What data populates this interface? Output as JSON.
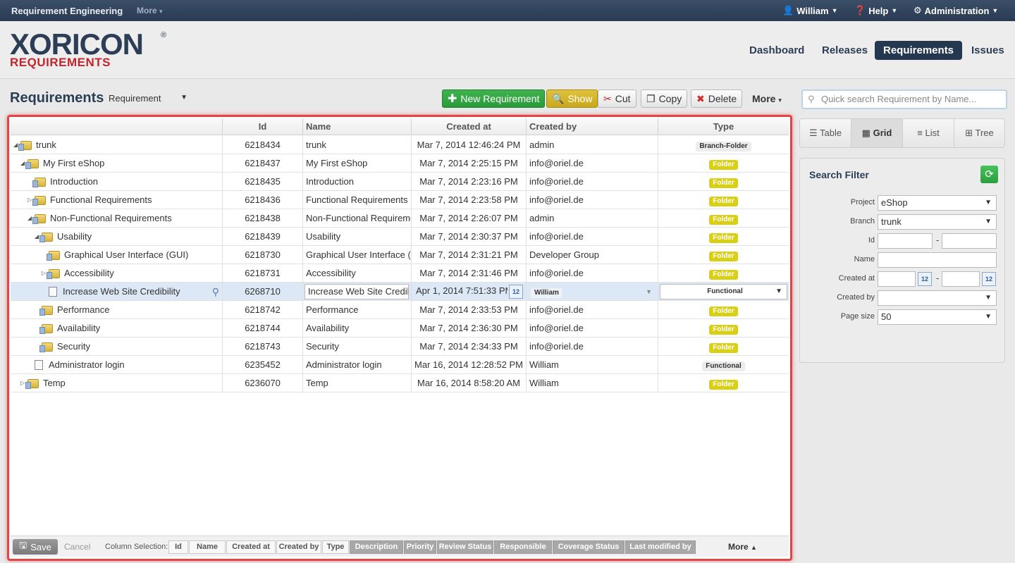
{
  "topbar": {
    "app_title": "Requirement Engineering",
    "more_label": "More",
    "user_label": "William",
    "help_label": "Help",
    "admin_label": "Administration"
  },
  "logo": {
    "main": "XORICON",
    "sub": "REQUIREMENTS",
    "reg": "®"
  },
  "nav": {
    "items": [
      {
        "label": "Dashboard"
      },
      {
        "label": "Releases"
      },
      {
        "label": "Requirements"
      },
      {
        "label": "Issues"
      }
    ],
    "active": "Requirements"
  },
  "toolbar": {
    "page_title": "Requirements",
    "type_select": "Requirement",
    "new_label": "New Requirement",
    "show_label": "Show",
    "cut_label": "Cut",
    "copy_label": "Copy",
    "delete_label": "Delete",
    "more_label": "More",
    "search_placeholder": "Quick search Requirement by Name..."
  },
  "grid": {
    "columns": [
      "Id",
      "Name",
      "Created at",
      "Created by",
      "Type"
    ],
    "rows": [
      {
        "tree": "trunk",
        "id": "6218434",
        "name": "trunk",
        "created_at": "Mar 7, 2014 12:46:24 PM",
        "created_by": "admin",
        "type": "Branch-Folder"
      },
      {
        "tree": "My First eShop",
        "id": "6218437",
        "name": "My First eShop",
        "created_at": "Mar 7, 2014 2:25:15 PM",
        "created_by": "info@oriel.de",
        "type": "Folder"
      },
      {
        "tree": "Introduction",
        "id": "6218435",
        "name": "Introduction",
        "created_at": "Mar 7, 2014 2:23:16 PM",
        "created_by": "info@oriel.de",
        "type": "Folder"
      },
      {
        "tree": "Functional Requirements",
        "id": "6218436",
        "name": "Functional Requirements",
        "created_at": "Mar 7, 2014 2:23:58 PM",
        "created_by": "info@oriel.de",
        "type": "Folder"
      },
      {
        "tree": "Non-Functional Requirements",
        "id": "6218438",
        "name": "Non-Functional Requireme",
        "created_at": "Mar 7, 2014 2:26:07 PM",
        "created_by": "admin",
        "type": "Folder"
      },
      {
        "tree": "Usability",
        "id": "6218439",
        "name": "Usability",
        "created_at": "Mar 7, 2014 2:30:37 PM",
        "created_by": "info@oriel.de",
        "type": "Folder"
      },
      {
        "tree": "Graphical User Interface (GUI)",
        "id": "6218730",
        "name": "Graphical User Interface (",
        "created_at": "Mar 7, 2014 2:31:21 PM",
        "created_by": "Developer Group",
        "type": "Folder"
      },
      {
        "tree": "Accessibility",
        "id": "6218731",
        "name": "Accessibility",
        "created_at": "Mar 7, 2014 2:31:46 PM",
        "created_by": "info@oriel.de",
        "type": "Folder"
      },
      {
        "tree": "Increase Web Site Credibility",
        "id": "6268710",
        "name": "Increase Web Site Credibi",
        "created_at": "Apr 1, 2014 7:51:33 PM",
        "created_by": "William",
        "type": "Functional"
      },
      {
        "tree": "Performance",
        "id": "6218742",
        "name": "Performance",
        "created_at": "Mar 7, 2014 2:33:53 PM",
        "created_by": "info@oriel.de",
        "type": "Folder"
      },
      {
        "tree": "Availability",
        "id": "6218744",
        "name": "Availability",
        "created_at": "Mar 7, 2014 2:36:30 PM",
        "created_by": "info@oriel.de",
        "type": "Folder"
      },
      {
        "tree": "Security",
        "id": "6218743",
        "name": "Security",
        "created_at": "Mar 7, 2014 2:34:33 PM",
        "created_by": "info@oriel.de",
        "type": "Folder"
      },
      {
        "tree": "Administrator login",
        "id": "6235452",
        "name": "Administrator login",
        "created_at": "Mar 16, 2014 12:28:52 PM",
        "created_by": "William",
        "type": "Functional"
      },
      {
        "tree": "Temp",
        "id": "6236070",
        "name": "Temp",
        "created_at": "Mar 16, 2014 8:58:20 AM",
        "created_by": "William",
        "type": "Folder"
      }
    ]
  },
  "footer": {
    "save_label": "Save",
    "cancel_label": "Cancel",
    "column_selection_label": "Column Selection:",
    "column_buttons": [
      "Id",
      "Name",
      "Created at",
      "Created by",
      "Type",
      "Description",
      "Priority",
      "Review Status",
      "Responsible",
      "Coverage Status",
      "Last modified by"
    ],
    "more_label": "More"
  },
  "views": {
    "items": [
      "Table",
      "Grid",
      "List",
      "Tree"
    ],
    "active": "Grid"
  },
  "filter": {
    "title": "Search Filter",
    "project_label": "Project",
    "project_value": "eShop",
    "branch_label": "Branch",
    "branch_value": "trunk",
    "id_label": "Id",
    "name_label": "Name",
    "created_at_label": "Created at",
    "created_by_label": "Created by",
    "page_size_label": "Page size",
    "page_size_value": "50",
    "calendar_day": "12"
  },
  "colors": {
    "accent": "#243850",
    "brand_red": "#c0262c",
    "folder_badge": "#d9cf14",
    "selection_border": "#e54444"
  }
}
